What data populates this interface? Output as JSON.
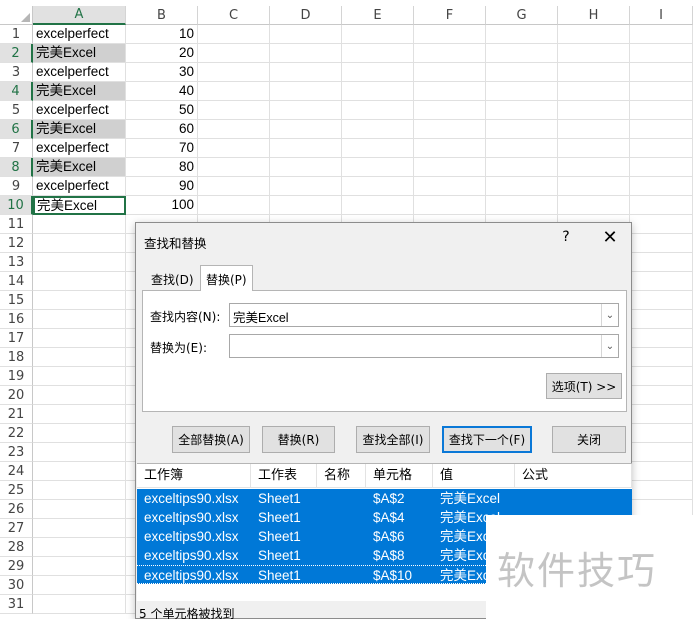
{
  "sheet": {
    "columns": [
      "A",
      "B",
      "C",
      "D",
      "E",
      "F",
      "G",
      "H",
      "I"
    ],
    "rows": [
      {
        "n": "1",
        "a": "excelperfect",
        "b": "10"
      },
      {
        "n": "2",
        "a": "完美Excel",
        "b": "20"
      },
      {
        "n": "3",
        "a": "excelperfect",
        "b": "30"
      },
      {
        "n": "4",
        "a": "完美Excel",
        "b": "40"
      },
      {
        "n": "5",
        "a": "excelperfect",
        "b": "50"
      },
      {
        "n": "6",
        "a": "完美Excel",
        "b": "60"
      },
      {
        "n": "7",
        "a": "excelperfect",
        "b": "70"
      },
      {
        "n": "8",
        "a": "完美Excel",
        "b": "80"
      },
      {
        "n": "9",
        "a": "excelperfect",
        "b": "90"
      },
      {
        "n": "10",
        "a": "完美Excel",
        "b": "100"
      },
      {
        "n": "11",
        "a": "",
        "b": ""
      },
      {
        "n": "12",
        "a": "",
        "b": ""
      },
      {
        "n": "13",
        "a": "",
        "b": ""
      },
      {
        "n": "14",
        "a": "",
        "b": ""
      },
      {
        "n": "15",
        "a": "",
        "b": ""
      },
      {
        "n": "16",
        "a": "",
        "b": ""
      },
      {
        "n": "17",
        "a": "",
        "b": ""
      },
      {
        "n": "18",
        "a": "",
        "b": ""
      },
      {
        "n": "19",
        "a": "",
        "b": ""
      },
      {
        "n": "20",
        "a": "",
        "b": ""
      },
      {
        "n": "21",
        "a": "",
        "b": ""
      },
      {
        "n": "22",
        "a": "",
        "b": ""
      },
      {
        "n": "23",
        "a": "",
        "b": ""
      },
      {
        "n": "24",
        "a": "",
        "b": ""
      },
      {
        "n": "25",
        "a": "",
        "b": ""
      },
      {
        "n": "26",
        "a": "",
        "b": ""
      },
      {
        "n": "27",
        "a": "",
        "b": ""
      },
      {
        "n": "28",
        "a": "",
        "b": ""
      },
      {
        "n": "29",
        "a": "",
        "b": ""
      },
      {
        "n": "30",
        "a": "",
        "b": ""
      },
      {
        "n": "31",
        "a": "",
        "b": ""
      }
    ]
  },
  "dialog": {
    "title": "查找和替换",
    "help": "?",
    "close": "✕",
    "tabs": {
      "find": "查找(D)",
      "replace": "替换(P)"
    },
    "find_label": "查找内容(N):",
    "find_value": "完美Excel",
    "replace_label": "替换为(E):",
    "replace_value": "",
    "options_button": "选项(T) >>",
    "buttons": {
      "replace_all": "全部替换(A)",
      "replace": "替换(R)",
      "find_all": "查找全部(I)",
      "find_next": "查找下一个(F)",
      "close": "关闭"
    },
    "results_headers": [
      "工作簿",
      "工作表",
      "名称",
      "单元格",
      "值",
      "公式"
    ],
    "results": [
      {
        "book": "exceltips90.xlsx",
        "sheet": "Sheet1",
        "name": "",
        "cell": "$A$2",
        "value": "完美Excel",
        "formula": ""
      },
      {
        "book": "exceltips90.xlsx",
        "sheet": "Sheet1",
        "name": "",
        "cell": "$A$4",
        "value": "完美Excel",
        "formula": ""
      },
      {
        "book": "exceltips90.xlsx",
        "sheet": "Sheet1",
        "name": "",
        "cell": "$A$6",
        "value": "完美Excel",
        "formula": ""
      },
      {
        "book": "exceltips90.xlsx",
        "sheet": "Sheet1",
        "name": "",
        "cell": "$A$8",
        "value": "完美Excel",
        "formula": ""
      },
      {
        "book": "exceltips90.xlsx",
        "sheet": "Sheet1",
        "name": "",
        "cell": "$A$10",
        "value": "完美Excel",
        "formula": ""
      }
    ],
    "status": "5 个单元格被找到"
  },
  "watermark": "软件技巧",
  "colors": {
    "accent": "#217346",
    "selection": "#0078d7",
    "highlight": "#d0d0d0"
  }
}
